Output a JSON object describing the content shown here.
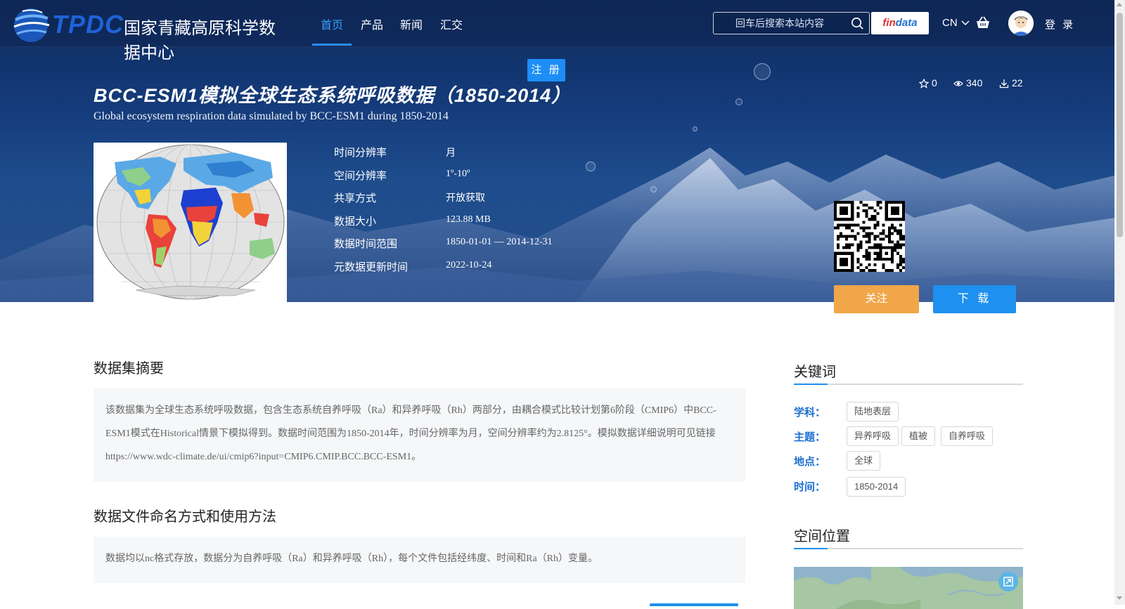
{
  "nav": {
    "logo_abbr": "TPDC",
    "logo_name": "国家青藏高原科学数据中心",
    "items": [
      {
        "label": "首页",
        "active": true
      },
      {
        "label": "产品",
        "active": false
      },
      {
        "label": "新闻",
        "active": false
      },
      {
        "label": "汇交",
        "active": false
      }
    ],
    "search_placeholder": "回车后搜索本站内容",
    "findata_prefix": "fin",
    "findata_suffix": "data",
    "lang": "CN",
    "login": "登 录",
    "register": "注 册"
  },
  "dataset": {
    "title": "BCC-ESM1模拟全球生态系统呼吸数据（1850-2014）",
    "subtitle": "Global ecosystem respiration data simulated by BCC-ESM1 during 1850-2014",
    "stats": {
      "stars": "0",
      "views": "340",
      "downloads": "22"
    },
    "meta": [
      {
        "label": "时间分辨率",
        "value": "月"
      },
      {
        "label": "空间分辨率",
        "value": "1º-10º"
      },
      {
        "label": "共享方式",
        "value": "开放获取"
      },
      {
        "label": "数据大小",
        "value": "123.88 MB"
      },
      {
        "label": "数据时间范围",
        "value": "1850-01-01 — 2014-12-31"
      },
      {
        "label": "元数据更新时间",
        "value": "2022-10-24"
      }
    ],
    "follow_label": "关注",
    "download_label": "下 载"
  },
  "content": {
    "abstract_title": "数据集摘要",
    "abstract_text": "该数据集为全球生态系统呼吸数据，包含生态系统自养呼吸（Ra）和异养呼吸（Rh）两部分，由耦合模式比较计划第6阶段（CMIP6）中BCC-ESM1模式在Historical情景下模拟得到。数据时间范围为1850-2014年，时间分辨率为月，空间分辨率约为2.8125°。模拟数据详细说明可见链接https://www.wdc-climate.de/ui/cmip6?input=CMIP6.CMIP.BCC.BCC-ESM1。",
    "naming_title": "数据文件命名方式和使用方法",
    "naming_text": "数据均以nc格式存放，数据分为自养呼吸（Ra）和异养呼吸（Rh），每个文件包括经纬度、时间和Ra（Rh）变量。"
  },
  "sidebar": {
    "keywords_title": "关键词",
    "groups": [
      {
        "label": "学科：",
        "tags": [
          "陆地表层"
        ]
      },
      {
        "label": "主题：",
        "tags": [
          "异养呼吸",
          "植被",
          "自养呼吸"
        ]
      },
      {
        "label": "地点：",
        "tags": [
          "全球"
        ]
      },
      {
        "label": "时间：",
        "tags": [
          "1850-2014"
        ]
      }
    ],
    "location_title": "空间位置"
  },
  "colors": {
    "accent": "#1e90ef",
    "follow": "#f0a649",
    "keyword_label": "#1e6fd1"
  }
}
